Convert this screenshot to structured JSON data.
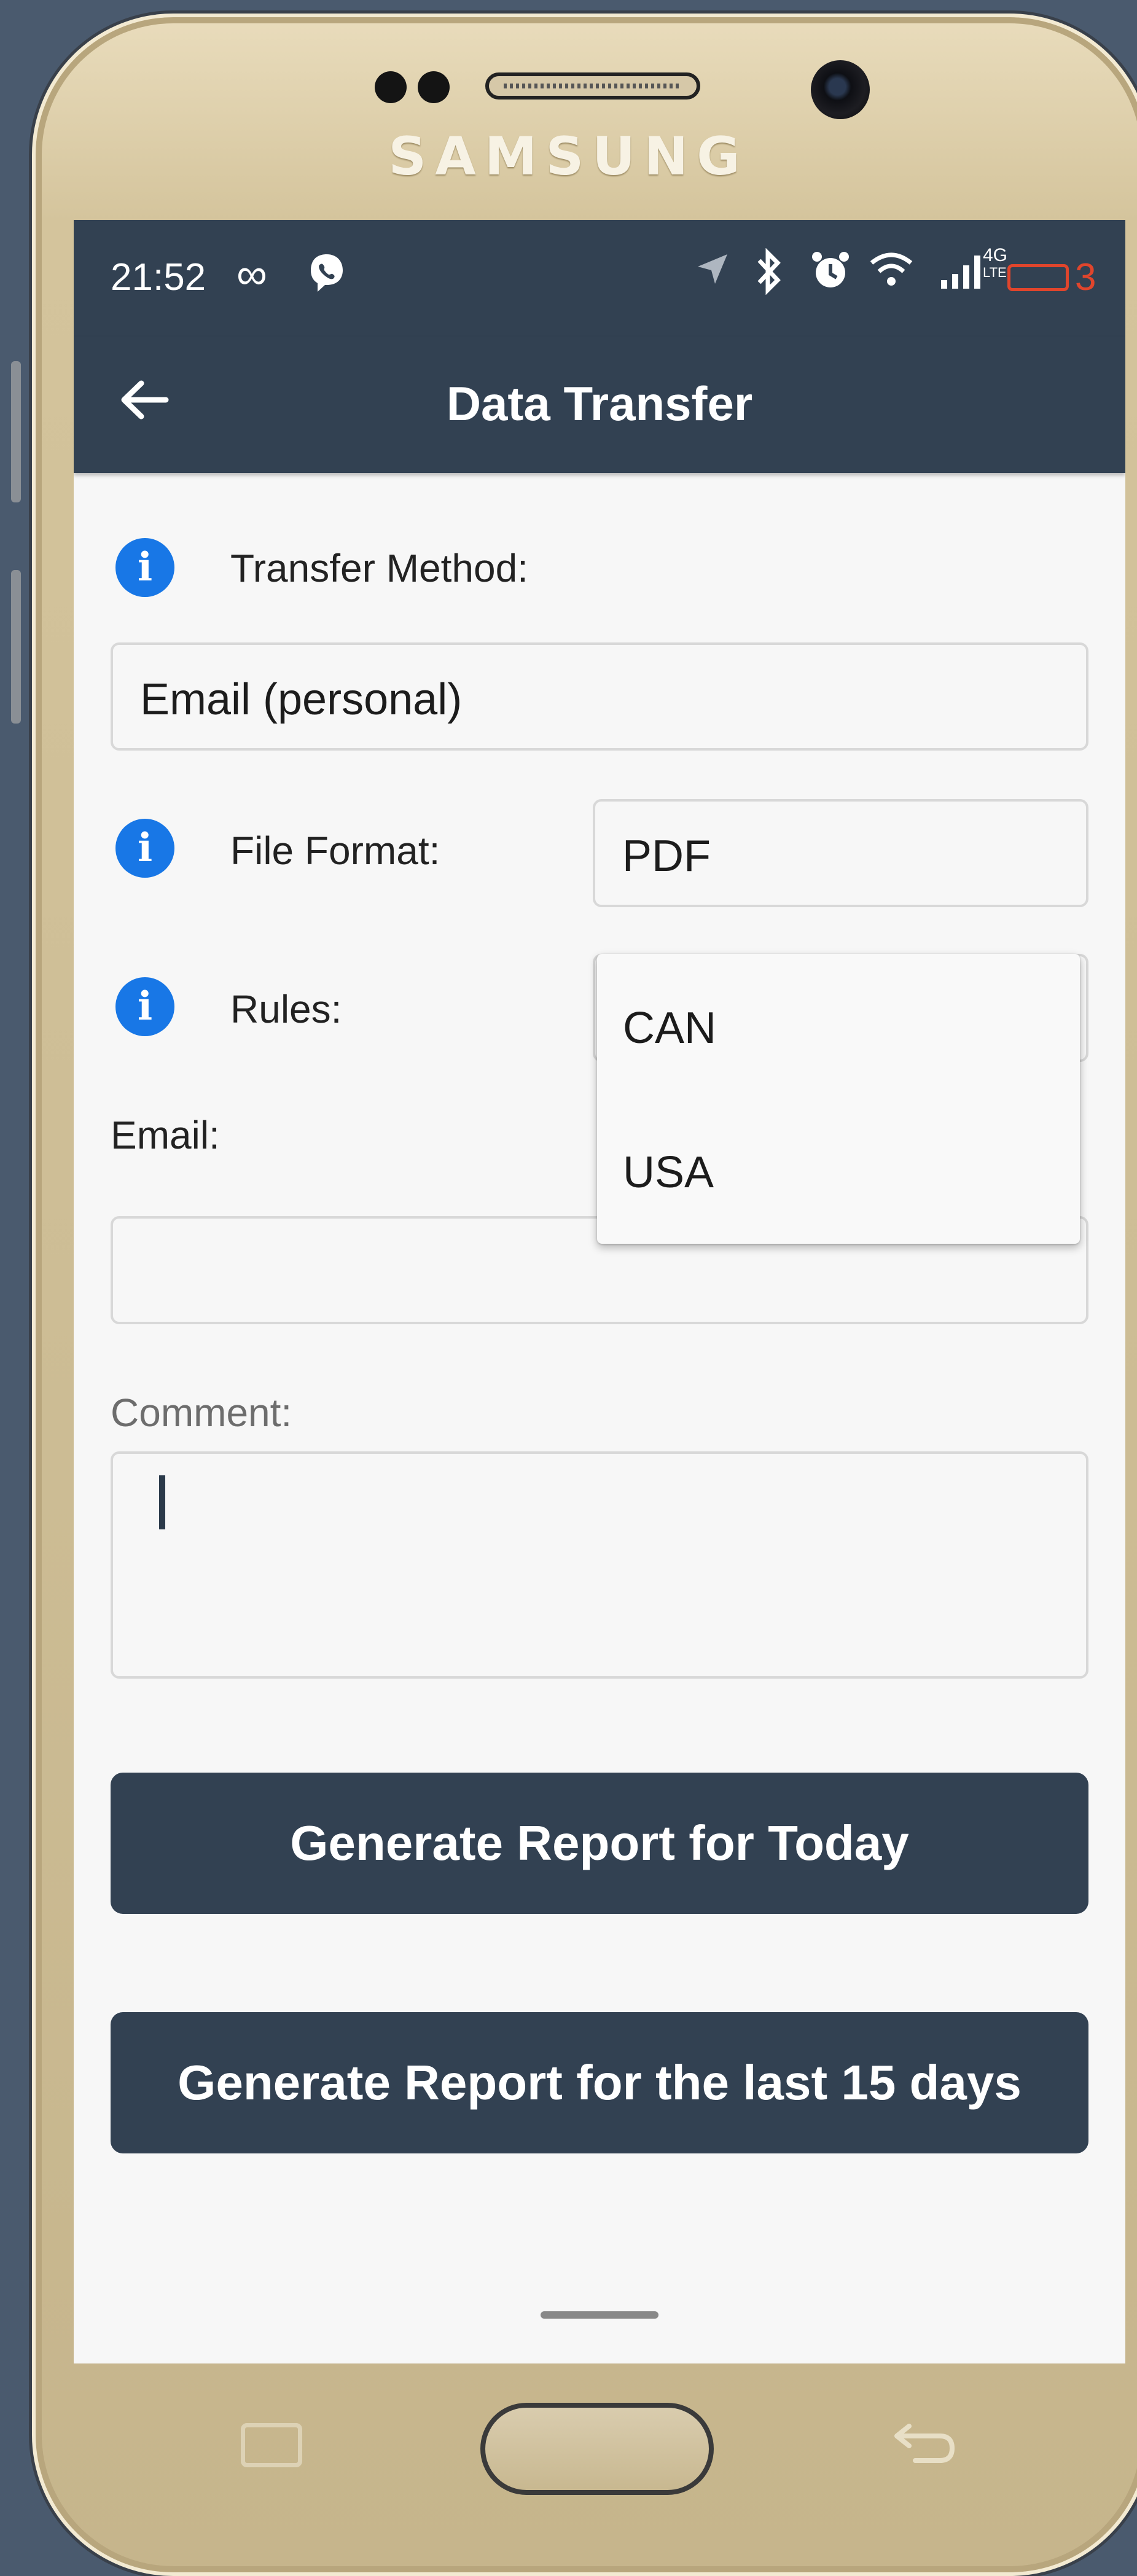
{
  "device": {
    "brand": "SAMSUNG"
  },
  "status_bar": {
    "time": "21:52",
    "left_icons": [
      "infinity-icon",
      "viber-icon"
    ],
    "right_icons": [
      "location-arrow-icon",
      "bluetooth-icon",
      "alarm-icon",
      "wifi-icon",
      "signal-icon",
      "4g-lte-icon",
      "battery-icon"
    ],
    "battery_level": "3",
    "network": "4G",
    "network_sub": "LTE"
  },
  "app_bar": {
    "title": "Data Transfer"
  },
  "form": {
    "transfer_method_label": "Transfer Method:",
    "transfer_method_value": "Email (personal)",
    "file_format_label": "File Format:",
    "file_format_value": "PDF",
    "rules_label": "Rules:",
    "email_label": "Email:",
    "email_value": "",
    "comment_label": "Comment:",
    "comment_value": ""
  },
  "rules_dropdown": {
    "options": [
      "CAN",
      "USA"
    ]
  },
  "buttons": {
    "today": "Generate Report for Today",
    "last15": "Generate Report for the last 15 days"
  },
  "colors": {
    "primary": "#324152",
    "info": "#1877e6",
    "battery_low": "#e0452c",
    "background": "#f7f7f7"
  }
}
